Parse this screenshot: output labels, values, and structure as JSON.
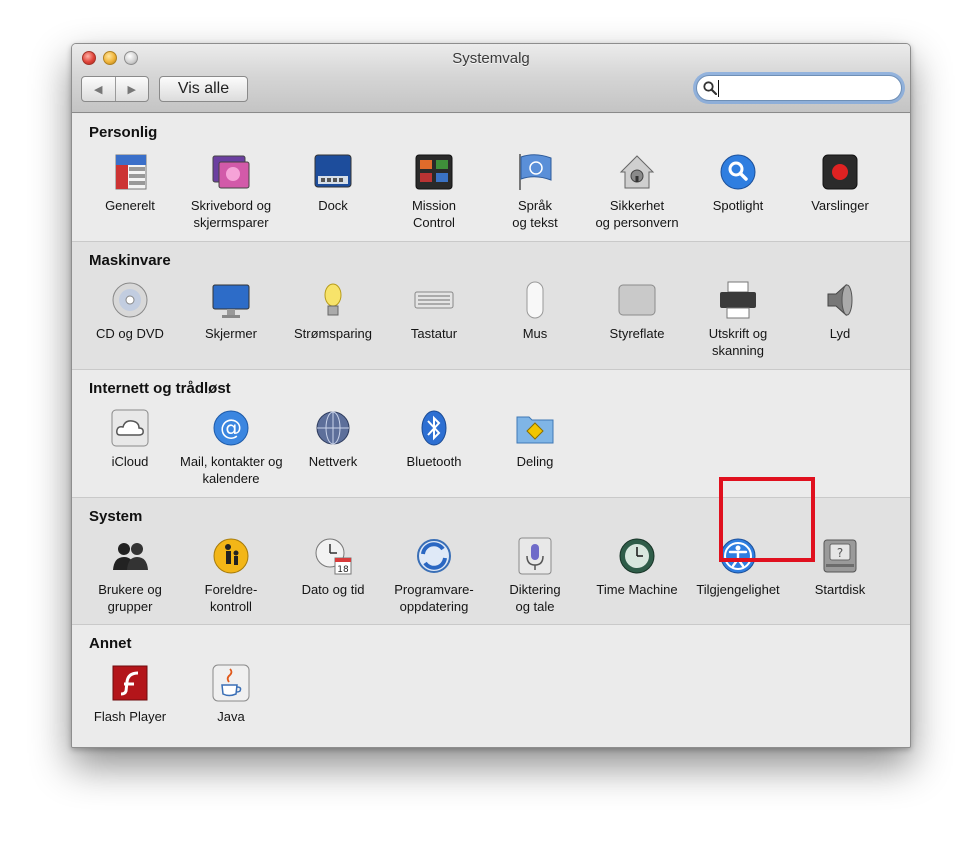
{
  "window": {
    "title": "Systemvalg",
    "show_all_label": "Vis alle",
    "search_value": "",
    "back_arrow": "◀",
    "forward_arrow": "▶"
  },
  "sections": {
    "personal": {
      "title": "Personlig",
      "items": [
        {
          "label": "Generelt",
          "icon": "general-icon"
        },
        {
          "label": "Skrivebord og\nskjermsparer",
          "icon": "desktop-screensaver-icon"
        },
        {
          "label": "Dock",
          "icon": "dock-icon"
        },
        {
          "label": "Mission\nControl",
          "icon": "mission-control-icon"
        },
        {
          "label": "Språk\nog tekst",
          "icon": "language-text-icon"
        },
        {
          "label": "Sikkerhet\nog personvern",
          "icon": "security-privacy-icon"
        },
        {
          "label": "Spotlight",
          "icon": "spotlight-icon"
        },
        {
          "label": "Varslinger",
          "icon": "notifications-icon"
        }
      ]
    },
    "hardware": {
      "title": "Maskinvare",
      "items": [
        {
          "label": "CD og DVD",
          "icon": "cd-dvd-icon"
        },
        {
          "label": "Skjermer",
          "icon": "displays-icon"
        },
        {
          "label": "Strømsparing",
          "icon": "energy-saver-icon"
        },
        {
          "label": "Tastatur",
          "icon": "keyboard-icon"
        },
        {
          "label": "Mus",
          "icon": "mouse-icon"
        },
        {
          "label": "Styreflate",
          "icon": "trackpad-icon"
        },
        {
          "label": "Utskrift og\nskanning",
          "icon": "print-scan-icon"
        },
        {
          "label": "Lyd",
          "icon": "sound-icon"
        }
      ]
    },
    "internet": {
      "title": "Internett og trådløst",
      "items": [
        {
          "label": "iCloud",
          "icon": "icloud-icon"
        },
        {
          "label": "Mail, kontakter og\nkalendere",
          "icon": "mail-contacts-calendars-icon"
        },
        {
          "label": "Nettverk",
          "icon": "network-icon"
        },
        {
          "label": "Bluetooth",
          "icon": "bluetooth-icon"
        },
        {
          "label": "Deling",
          "icon": "sharing-icon"
        }
      ]
    },
    "system": {
      "title": "System",
      "items": [
        {
          "label": "Brukere og\ngrupper",
          "icon": "users-groups-icon"
        },
        {
          "label": "Foreldre-\nkontroll",
          "icon": "parental-controls-icon"
        },
        {
          "label": "Dato og tid",
          "icon": "date-time-icon",
          "calendar_day": "18"
        },
        {
          "label": "Programvare-\noppdatering",
          "icon": "software-update-icon"
        },
        {
          "label": "Diktering\nog tale",
          "icon": "dictation-speech-icon"
        },
        {
          "label": "Time Machine",
          "icon": "time-machine-icon"
        },
        {
          "label": "Tilgjengelighet",
          "icon": "accessibility-icon"
        },
        {
          "label": "Startdisk",
          "icon": "startup-disk-icon"
        }
      ]
    },
    "other": {
      "title": "Annet",
      "items": [
        {
          "label": "Flash Player",
          "icon": "flash-player-icon"
        },
        {
          "label": "Java",
          "icon": "java-icon"
        }
      ]
    }
  },
  "colors": {
    "highlight": "#e0101e",
    "search_focus": "#6ea0e1",
    "accent_blue": "#1f6fd6"
  }
}
